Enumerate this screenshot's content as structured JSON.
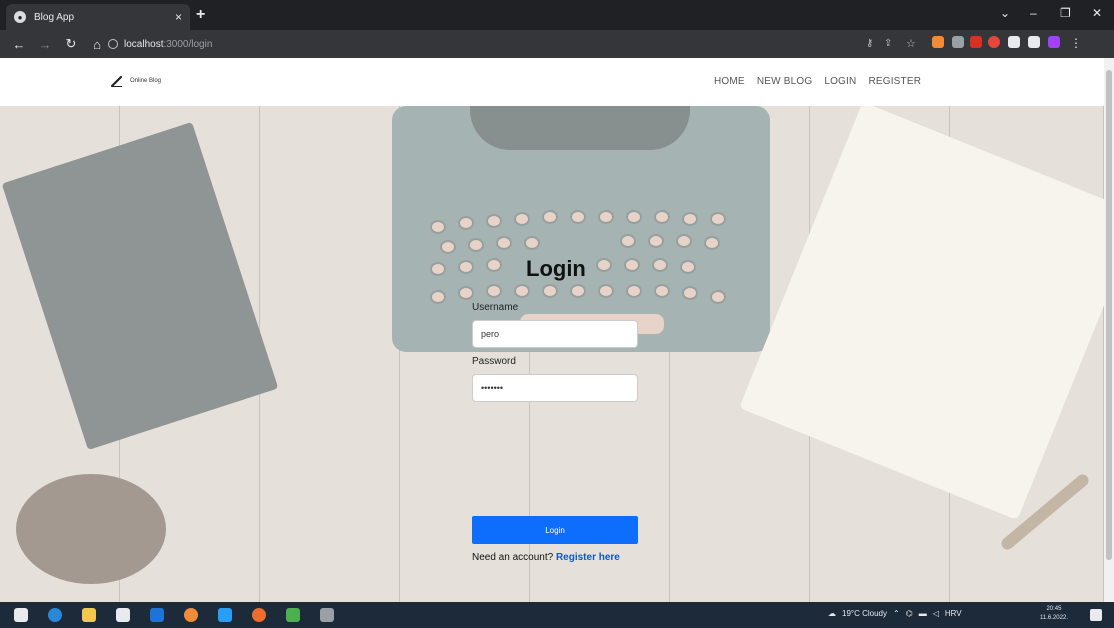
{
  "browser": {
    "tab_title": "Blog App",
    "tab_close": "×",
    "new_tab": "+",
    "url_host": "localhost",
    "url_path": ":3000/login",
    "win_min": "–",
    "win_max": "❐",
    "win_close": "✕"
  },
  "site": {
    "brand": "Online Blog",
    "nav": [
      "HOME",
      "NEW BLOG",
      "LOGIN",
      "REGISTER"
    ]
  },
  "login": {
    "title": "Login",
    "username_label": "Username",
    "username_value": "pero",
    "password_label": "Password",
    "password_value": "•••••••",
    "button": "Login",
    "register_prompt": "Need an account?",
    "register_link": "Register here"
  },
  "taskbar": {
    "weather": "19°C Cloudy",
    "lang": "HRV",
    "time": "20:45",
    "date": "11.6.2022."
  }
}
